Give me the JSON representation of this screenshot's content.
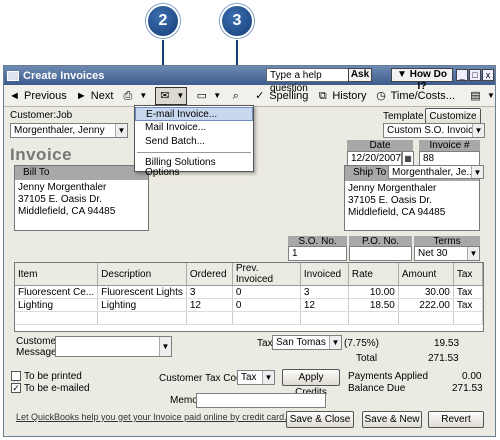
{
  "callouts": [
    "2",
    "3"
  ],
  "window": {
    "title": "Create Invoices",
    "help_placeholder": "Type a help question",
    "ask": "Ask",
    "how_do_i": "▼ How Do I?",
    "min": "_",
    "max": "□",
    "close": "x"
  },
  "toolbar": {
    "previous": "Previous",
    "next": "Next",
    "spelling": "Spelling",
    "history": "History",
    "time_costs": "Time/Costs..."
  },
  "send_menu": {
    "items": [
      "E-mail Invoice...",
      "Mail Invoice...",
      "Send Batch...",
      "Billing Solutions Options"
    ]
  },
  "form": {
    "customer_job_label": "Customer:Job",
    "customer_job": "Morgenthaler, Jenny",
    "template_label": "Template",
    "customize": "Customize",
    "template": "Custom S.O. Invoice",
    "title": "Invoice",
    "date_label": "Date",
    "date": "12/20/2007",
    "invoice_no_label": "Invoice #",
    "invoice_no": "88",
    "bill_to_label": "Bill To",
    "bill_to": [
      "Jenny Morgenthaler",
      "37105 E. Oasis Dr.",
      "Middlefield, CA 94485"
    ],
    "ship_to_label": "Ship To",
    "ship_to_select": "Morgenthaler, Je...",
    "ship_to": [
      "Jenny Morgenthaler",
      "37105 E. Oasis Dr.",
      "Middlefield, CA 94485"
    ],
    "so_no_label": "S.O. No.",
    "so_no": "1",
    "po_no_label": "P.O. No.",
    "po_no": "",
    "terms_label": "Terms",
    "terms": "Net 30"
  },
  "items": {
    "columns": [
      "Item",
      "Description",
      "Ordered",
      "Prev. Invoiced",
      "Invoiced",
      "Rate",
      "Amount",
      "Tax"
    ],
    "rows": [
      [
        "Fluorescent Ce...",
        "Fluorescent Lights",
        "3",
        "0",
        "3",
        "10.00",
        "30.00",
        "Tax"
      ],
      [
        "Lighting",
        "Lighting",
        "12",
        "0",
        "12",
        "18.50",
        "222.00",
        "Tax"
      ]
    ]
  },
  "footer": {
    "customer_message_label": "Customer Message",
    "tax_label": "Tax",
    "tax_item": "San Tomas",
    "tax_rate": "(7.75%)",
    "tax_amount": "19.53",
    "total_label": "Total",
    "total": "271.53",
    "to_be_printed": "To be printed",
    "to_be_emailed": "To be e-mailed",
    "customer_tax_code_label": "Customer Tax Code",
    "customer_tax_code": "Tax",
    "apply_credits": "Apply Credits",
    "payments_applied_label": "Payments Applied",
    "payments_applied": "0.00",
    "balance_due_label": "Balance Due",
    "balance_due": "271.53",
    "memo_label": "Memo",
    "online_link": "Let QuickBooks help you get your Invoice paid online by credit card.",
    "save_close": "Save & Close",
    "save_new": "Save & New",
    "revert": "Revert"
  }
}
